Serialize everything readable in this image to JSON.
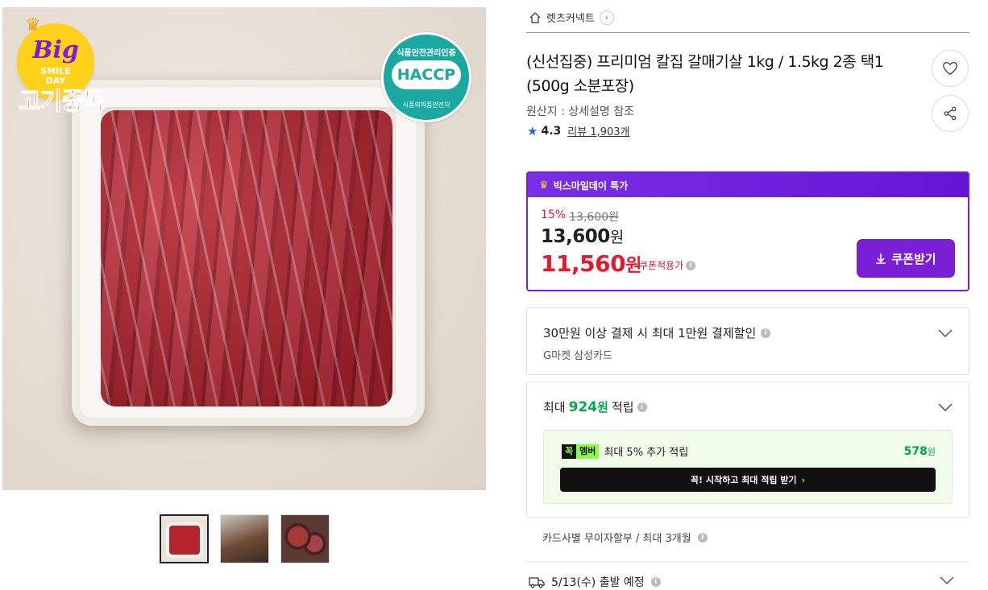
{
  "image": {
    "badge_big": "Big",
    "badge_smile": "SMILE",
    "badge_day": "DAY",
    "brand_logo": "고기중독",
    "haccp_top": "식품안전관리인증",
    "haccp_mid": "HACCP",
    "haccp_bottom": "식품의약품안전처"
  },
  "store": {
    "name": "렛츠커넥트"
  },
  "product": {
    "title": "(신선집중) 프리미엄 칼집 갈매기살 1kg / 1.5kg 2종 택1 (500g 소분포장)",
    "origin": "원산지 : 상세설명 참조",
    "rating": "4.3",
    "review_label": "리뷰 1,903개"
  },
  "deal": {
    "header": "빅스마일데이 특가",
    "discount_pct": "15%",
    "original_price": "13,600원",
    "price_num": "13,600",
    "price_unit": "원",
    "sale_num": "11,560",
    "sale_unit": "원",
    "coupon_note": "쿠폰적용가",
    "coupon_button": "쿠폰받기"
  },
  "payment": {
    "title": "30만원 이상 결제 시 최대 1만원 결제할인",
    "sub": "G마켓 삼성카드"
  },
  "earn": {
    "prefix": "최대",
    "amount": "924",
    "unit": "원",
    "suffix": "적립",
    "member_tag_a": "꼭",
    "member_tag_b": "멤버",
    "member_text": "최대 5% 추가 적립",
    "member_amount": "578",
    "member_unit": "원",
    "member_button": "꼭! 시작하고 최대 적립 받기"
  },
  "installment": "카드사별 무이자할부 / 최대 3개월",
  "shipping": "5/13(수) 출발 예정",
  "colors": {
    "accent_purple": "#7b1fd6",
    "sale_red": "#e8172c",
    "earn_green": "#00a84f",
    "rating_blue": "#1e64f0"
  }
}
